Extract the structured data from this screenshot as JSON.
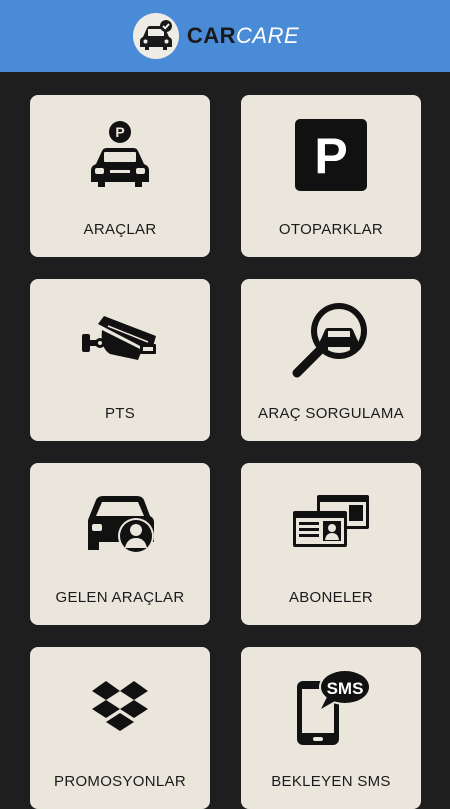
{
  "app": {
    "logo_car": "CAR",
    "logo_care": "CARE"
  },
  "menu": [
    {
      "label": "ARAÇLAR",
      "icon": "parked-car-icon"
    },
    {
      "label": "OTOPARKLAR",
      "icon": "parking-sign-icon"
    },
    {
      "label": "PTS",
      "icon": "security-camera-icon"
    },
    {
      "label": "ARAÇ SORGULAMA",
      "icon": "vehicle-search-icon"
    },
    {
      "label": "GELEN ARAÇLAR",
      "icon": "car-user-icon"
    },
    {
      "label": "ABONELER",
      "icon": "id-cards-icon"
    },
    {
      "label": "PROMOSYONLAR",
      "icon": "dropbox-box-icon"
    },
    {
      "label": "BEKLEYEN SMS",
      "icon": "phone-sms-icon"
    }
  ],
  "icon_texts": {
    "parking_letter": "P",
    "sms_text": "SMS"
  },
  "colors": {
    "header": "#4a8bd8",
    "background": "#1e1e1e",
    "tile": "#ebe6dc",
    "icon": "#111111"
  }
}
